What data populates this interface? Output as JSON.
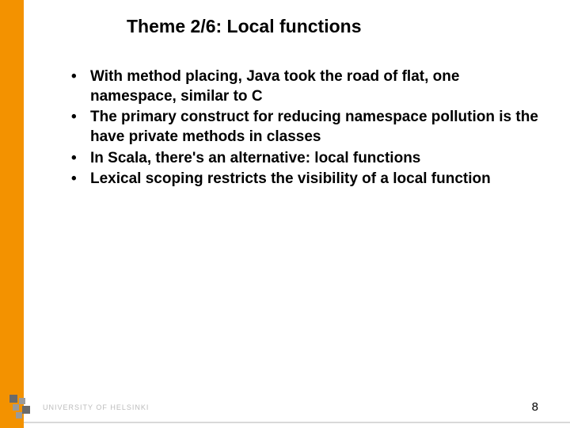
{
  "colors": {
    "accent": "#f39200",
    "logo_dark": "#5a5a5a",
    "logo_light": "#bcbcbc"
  },
  "slide": {
    "title": "Theme 2/6: Local functions",
    "bullets": [
      "With method placing, Java took the road of flat, one namespace, similar to C",
      "The primary construct for reducing namespace pollution is the have private methods in classes",
      "In Scala, there's an alternative: local functions",
      "Lexical scoping restricts the visibility of a local function"
    ]
  },
  "footer": {
    "institution": "UNIVERSITY OF HELSINKI",
    "page_number": "8"
  }
}
